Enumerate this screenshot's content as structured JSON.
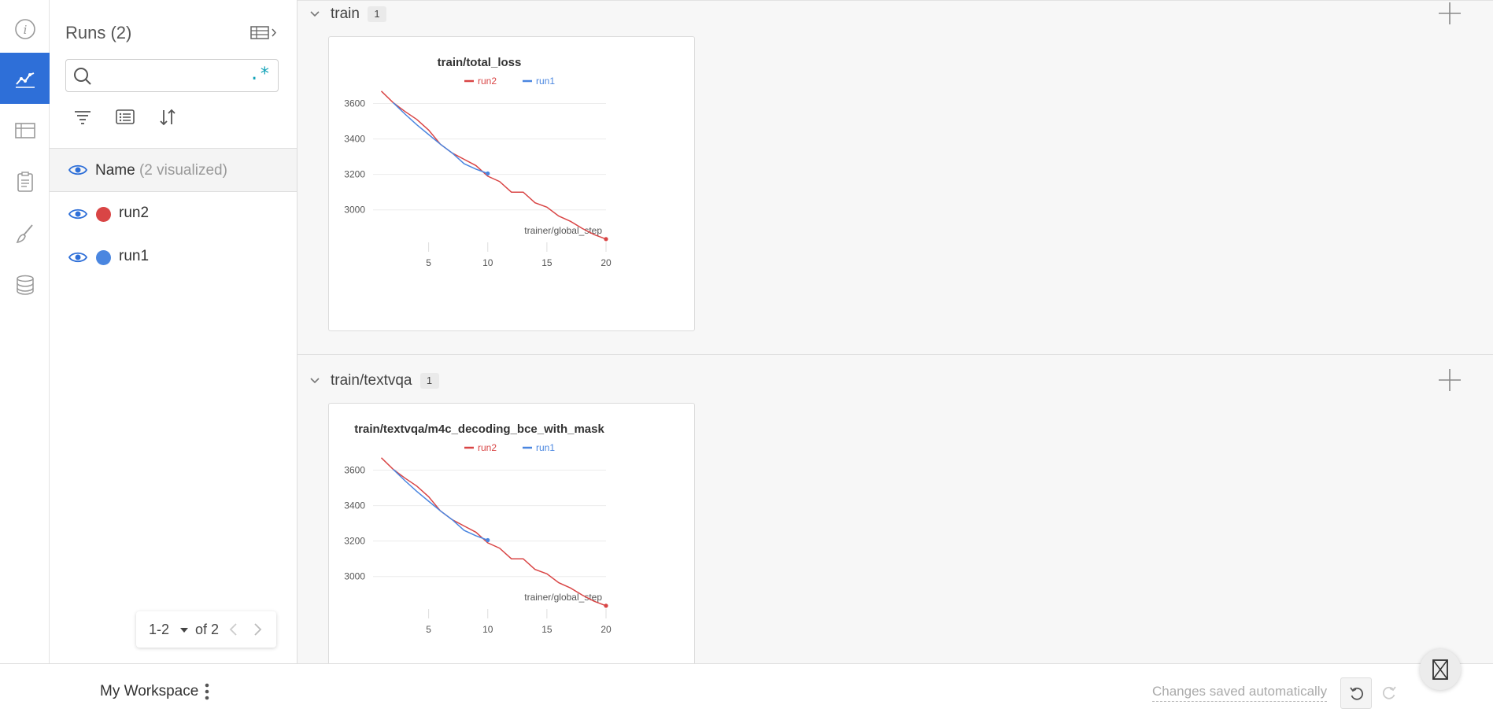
{
  "sidebar": {
    "items": [
      {
        "icon": "info-icon",
        "active": false
      },
      {
        "icon": "chart-icon",
        "active": true
      },
      {
        "icon": "table-icon",
        "active": false
      },
      {
        "icon": "clipboard-icon",
        "active": false
      },
      {
        "icon": "brush-icon",
        "active": false
      },
      {
        "icon": "database-icon",
        "active": false
      }
    ],
    "accent": "#2e6fd8"
  },
  "runs_panel": {
    "title": "Runs (2)",
    "search": {
      "value": "",
      "placeholder": "",
      "regex_label": ".*"
    },
    "header": {
      "label": "Name",
      "visualized": "(2 visualized)"
    },
    "runs": [
      {
        "name": "run2",
        "color": "#d94545"
      },
      {
        "name": "run1",
        "color": "#4a86e0"
      }
    ],
    "pager": {
      "range": "1-2",
      "total": "of 2"
    }
  },
  "sections": [
    {
      "title": "train",
      "count": "1",
      "panel": {
        "title": "train/total_loss",
        "legend": [
          "run2",
          "run1"
        ],
        "xlabel": "trainer/global_step"
      }
    },
    {
      "title": "train/textvqa",
      "count": "1",
      "panel": {
        "title": "train/textvqa/m4c_decoding_bce_with_mask",
        "legend": [
          "run2",
          "run1"
        ],
        "xlabel": "trainer/global_step"
      }
    }
  ],
  "chart_data": [
    {
      "type": "line",
      "title": "train/total_loss",
      "xlabel": "trainer/global_step",
      "ylabel": "",
      "x_ticks": [
        5,
        10,
        15,
        20
      ],
      "y_ticks": [
        3000,
        3200,
        3400,
        3600
      ],
      "xlim": [
        0.3,
        20
      ],
      "ylim": [
        2830,
        3700
      ],
      "legend": "top",
      "grid": true,
      "series": [
        {
          "name": "run2",
          "color": "#d94545",
          "x": [
            1,
            2,
            3,
            4,
            5,
            6,
            7,
            8,
            9,
            10,
            11,
            12,
            13,
            14,
            15,
            16,
            17,
            18,
            19,
            20
          ],
          "y": [
            3670,
            3605,
            3555,
            3510,
            3450,
            3370,
            3320,
            3285,
            3250,
            3190,
            3160,
            3100,
            3100,
            3040,
            3015,
            2965,
            2935,
            2895,
            2860,
            2835
          ]
        },
        {
          "name": "run1",
          "color": "#4a86e0",
          "x": [
            2,
            3,
            4,
            5,
            6,
            7,
            8,
            9,
            10
          ],
          "y": [
            3605,
            3540,
            3480,
            3425,
            3370,
            3320,
            3260,
            3230,
            3205
          ]
        }
      ]
    },
    {
      "type": "line",
      "title": "train/textvqa/m4c_decoding_bce_with_mask",
      "xlabel": "trainer/global_step",
      "ylabel": "",
      "x_ticks": [
        5,
        10,
        15,
        20
      ],
      "y_ticks": [
        3000,
        3200,
        3400,
        3600
      ],
      "xlim": [
        0.3,
        20
      ],
      "ylim": [
        2830,
        3700
      ],
      "legend": "top",
      "grid": true,
      "series": [
        {
          "name": "run2",
          "color": "#d94545",
          "x": [
            1,
            2,
            3,
            4,
            5,
            6,
            7,
            8,
            9,
            10,
            11,
            12,
            13,
            14,
            15,
            16,
            17,
            18,
            19,
            20
          ],
          "y": [
            3670,
            3605,
            3555,
            3510,
            3450,
            3370,
            3320,
            3285,
            3250,
            3190,
            3160,
            3100,
            3100,
            3040,
            3015,
            2965,
            2935,
            2895,
            2860,
            2835
          ]
        },
        {
          "name": "run1",
          "color": "#4a86e0",
          "x": [
            2,
            3,
            4,
            5,
            6,
            7,
            8,
            9,
            10
          ],
          "y": [
            3605,
            3540,
            3480,
            3425,
            3370,
            3320,
            3260,
            3230,
            3205
          ]
        }
      ]
    }
  ],
  "footer": {
    "workspace": "My Workspace",
    "saved_status": "Changes saved automatically"
  }
}
